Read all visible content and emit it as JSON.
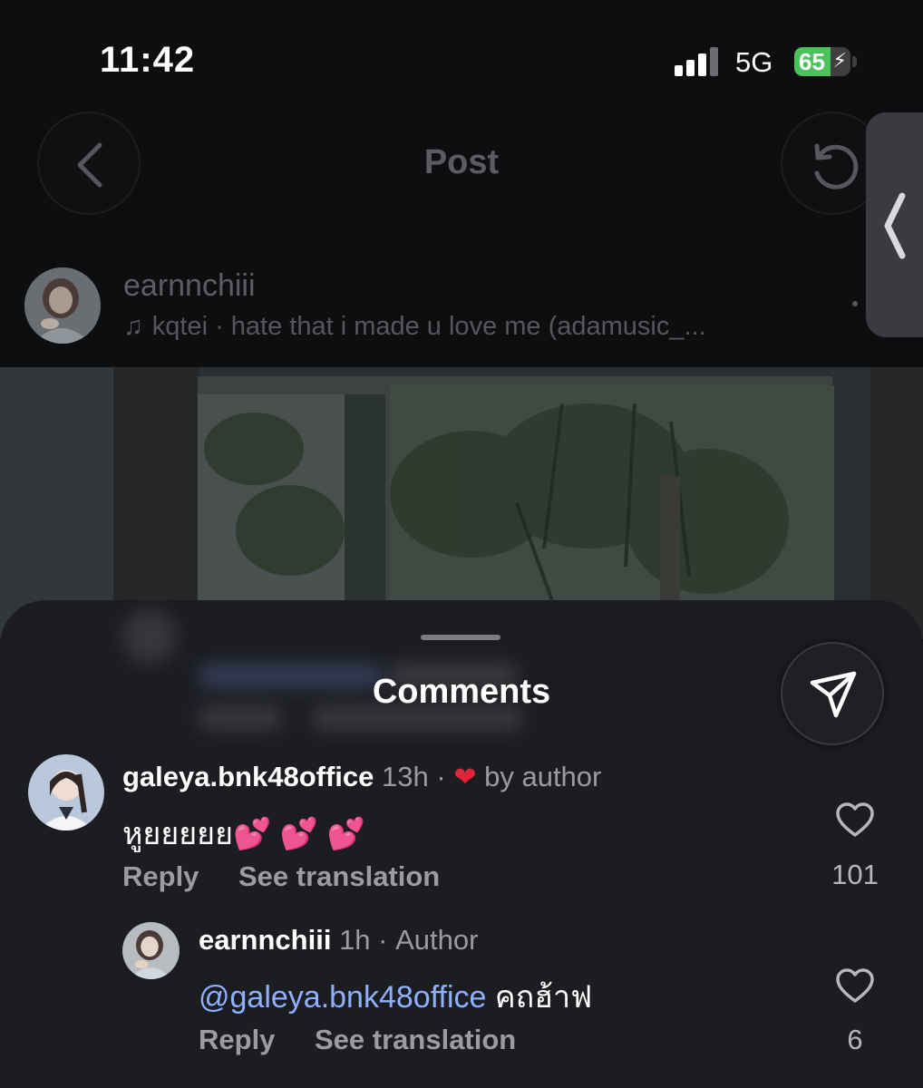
{
  "status_bar": {
    "time": "11:42",
    "network": "5G",
    "battery": "65",
    "battery_level": 0.65
  },
  "nav": {
    "title": "Post"
  },
  "post": {
    "username": "earnnchiii",
    "music": "kqtei · hate that i made u love me (adamusic_..."
  },
  "sheet": {
    "title": "Comments"
  },
  "comments": [
    {
      "username": "galeya.bnk48office",
      "time": "13h",
      "separator": "·",
      "liked_by": "by author",
      "text": "หูยยยยย💕 💕 💕",
      "reply_label": "Reply",
      "translate_label": "See translation",
      "likes": "101"
    },
    {
      "username": "earnnchiii",
      "time": "1h",
      "separator": "·",
      "badge": "Author",
      "mention": "@galeya.bnk48office",
      "text": " คถฮ้าฟ",
      "reply_label": "Reply",
      "translate_label": "See translation",
      "likes": "6"
    }
  ],
  "colors": {
    "background": "#1c1d21",
    "mention": "#8fb0ff",
    "like_heart": "#e0243a",
    "battery": "#4cc25c"
  }
}
